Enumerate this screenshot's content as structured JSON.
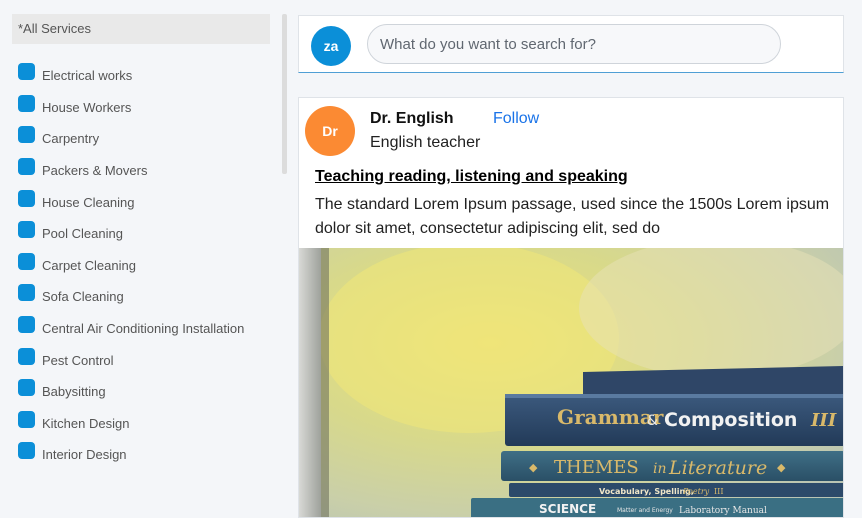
{
  "sidebar": {
    "all_services": "*All Services",
    "items": [
      {
        "label": "Electrical works"
      },
      {
        "label": "House Workers"
      },
      {
        "label": "Carpentry"
      },
      {
        "label": "Packers & Movers"
      },
      {
        "label": "House Cleaning"
      },
      {
        "label": "Pool Cleaning"
      },
      {
        "label": "Carpet Cleaning"
      },
      {
        "label": "Sofa Cleaning"
      },
      {
        "label": "Central Air Conditioning Installation"
      },
      {
        "label": "Pest Control"
      },
      {
        "label": "Babysitting"
      },
      {
        "label": "Kitchen Design"
      },
      {
        "label": "Interior Design"
      }
    ]
  },
  "search": {
    "avatar_initials": "za",
    "placeholder": "What do you want to search for?"
  },
  "post": {
    "avatar_initials": "Dr",
    "author_name": "Dr. English",
    "follow_label": "Follow",
    "author_role": "English teacher",
    "title": "Teaching reading, listening and speaking",
    "body": "The standard Lorem Ipsum passage, used since the 1500s Lorem ipsum dolor sit amet, consectetur adipiscing elit, sed do",
    "image": {
      "book1": "Grammar",
      "book1_amp": "&",
      "book1_b": "Composition",
      "book1_num": "III",
      "book2": "THEMES",
      "book2_in": "in",
      "book2_b": "Literature",
      "book3_a": "Vocabulary, Spelling,",
      "book3_b": "Poetry",
      "book3_c": "III",
      "book4": "SCIENCE",
      "book4_b": "Matter and Energy",
      "book4_c": "Laboratory Manual"
    }
  },
  "colors": {
    "accent": "#0b8fd8",
    "avatar_dr": "#fb8a33",
    "link": "#1a73e8"
  }
}
